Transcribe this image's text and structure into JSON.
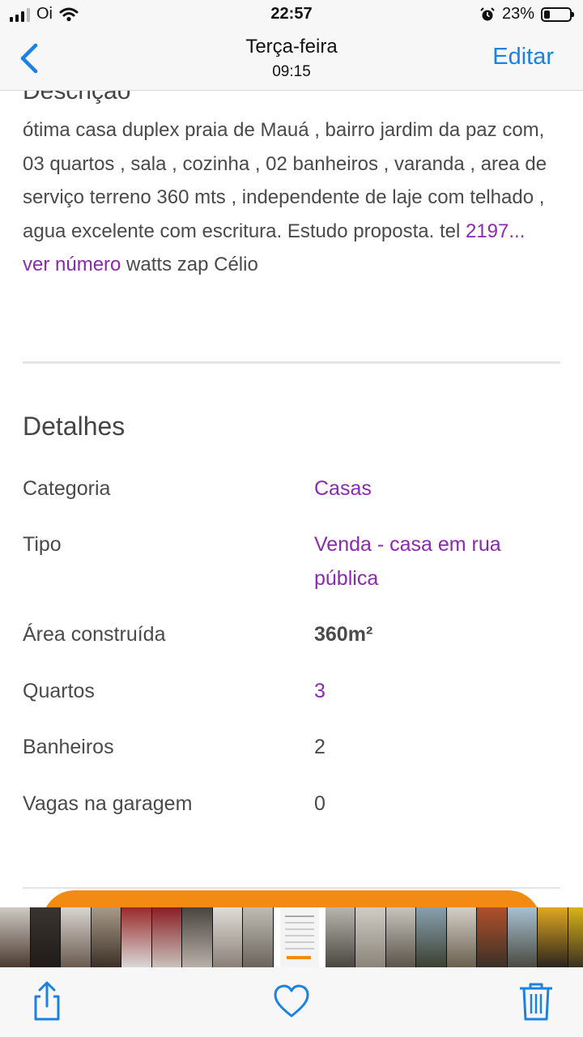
{
  "status_bar": {
    "carrier": "Oi",
    "time": "22:57",
    "battery": "23%",
    "battery_level": 0.23
  },
  "nav": {
    "title": "Terça-feira",
    "subtitle": "09:15",
    "edit_label": "Editar",
    "back_icon": "chevron-left-icon"
  },
  "description": {
    "heading": "Descrição",
    "text": "ótima casa duplex praia de Mauá , bairro jardim da paz com, 03 quartos , sala , cozinha , 02 banheiros , varanda , area de serviço terreno 360 mts , independente de laje com telhado , agua excelente com escritura. Estudo proposta. tel ",
    "phone_link": "2197... ver número",
    "suffix": " watts zap Célio"
  },
  "details": {
    "heading": "Detalhes",
    "rows": [
      {
        "label": "Categoria",
        "value": "Casas"
      },
      {
        "label": "Tipo",
        "value": "Venda - casa em rua pública"
      },
      {
        "label": "Área construída",
        "value": "360m²"
      },
      {
        "label": "Quartos",
        "value": "3"
      },
      {
        "label": "Banheiros",
        "value": "2"
      },
      {
        "label": "Vagas na garagem",
        "value": "0"
      }
    ]
  },
  "colors": {
    "accent_blue": "#1a82e2",
    "link_purple": "#8a2aaf",
    "orange": "#f28a14"
  },
  "toolbar": {
    "share_icon": "share-icon",
    "favorite_icon": "heart-icon",
    "delete_icon": "trash-icon"
  }
}
